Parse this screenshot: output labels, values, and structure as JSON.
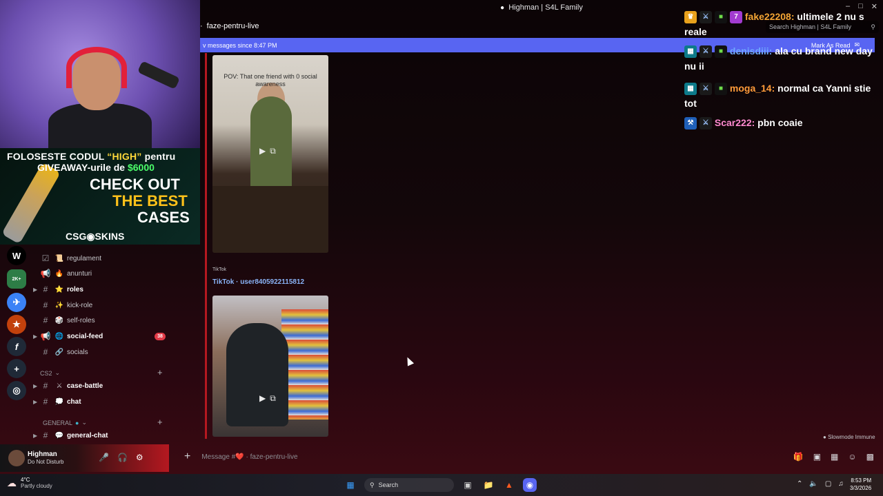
{
  "window": {
    "title": "Highman | S4L Family"
  },
  "channel_header": {
    "name": "faze-pentru-live"
  },
  "search": {
    "placeholder": "Search Highman | S4L Family"
  },
  "new_messages_bar": {
    "text": "v messages since 8:47 PM",
    "mark_read": "Mark As Read"
  },
  "promo": {
    "line1_a": "FOLOSESTE CODUL ",
    "line1_code": "“HIGH”",
    "line1_b": " pentru",
    "line2_a": "GIVEAWAY-urile de ",
    "line2_amount": "$6000",
    "check1": "CHECK OUT",
    "check2": "THE BEST",
    "check3": "CASES",
    "brand": "CSG◉SKINS"
  },
  "servers": [
    {
      "label": "W",
      "color": "#000000"
    },
    {
      "label": "2K+",
      "color": "#2d7d46"
    },
    {
      "label": "✈",
      "color": "#3b82f6"
    },
    {
      "label": "★",
      "color": "#c2410c"
    },
    {
      "label": "f",
      "color": "#1f2937"
    },
    {
      "label": "+",
      "color": "#1f2937"
    },
    {
      "label": "◎",
      "color": "#1f2937"
    }
  ],
  "channels": [
    {
      "name": "regulament",
      "emoji": "📜",
      "hash": "☑",
      "bold": false
    },
    {
      "name": "anunturi",
      "emoji": "🔥",
      "hash": "📢",
      "bold": false
    },
    {
      "name": "roles",
      "emoji": "⭐",
      "hash": "#",
      "bold": true
    },
    {
      "name": "kick-role",
      "emoji": "✨",
      "hash": "#",
      "bold": false
    },
    {
      "name": "self-roles",
      "emoji": "🎲",
      "hash": "#",
      "bold": false
    },
    {
      "name": "social-feed",
      "emoji": "🌐",
      "hash": "📢",
      "bold": true,
      "badge": "38"
    },
    {
      "name": "socials",
      "emoji": "🔗",
      "hash": "#",
      "bold": false
    }
  ],
  "categories": {
    "cs2": "CS2",
    "general": "GENERAL"
  },
  "cs2_channels": [
    {
      "name": "case-battle",
      "emoji": "⚔"
    },
    {
      "name": "chat",
      "emoji": "💭"
    }
  ],
  "general_channels": [
    {
      "name": "general-chat",
      "emoji": "💬"
    }
  ],
  "user": {
    "name": "Highman",
    "status": "Do Not Disturb"
  },
  "video1": {
    "caption": "POV: That one friend with 0 social awareness"
  },
  "embed": {
    "provider": "TikTok",
    "title": "TikTok · user8405922115812"
  },
  "chat": [
    {
      "user": "fake22208:",
      "msg": " ultimele 2 nu s reale"
    },
    {
      "user": "denisdiii:",
      "msg": " ala cu brand new day nu ii"
    },
    {
      "user": "moga_14:",
      "msg": " normal ca Yanni stie tot"
    },
    {
      "user": "Scar222:",
      "msg": " pbn coaie"
    }
  ],
  "slowmode": "Slowmode Immune",
  "composer": {
    "placeholder": "Message #❤️ · faze-pentru-live"
  },
  "taskbar": {
    "temp": "4°C",
    "weather": "Partly cloudy",
    "search": "Search",
    "time": "8:53 PM",
    "date": "3/3/2026"
  },
  "colors": {
    "accent": "#5865f2",
    "brand_red": "#b51820",
    "link": "#8ab4f8"
  }
}
